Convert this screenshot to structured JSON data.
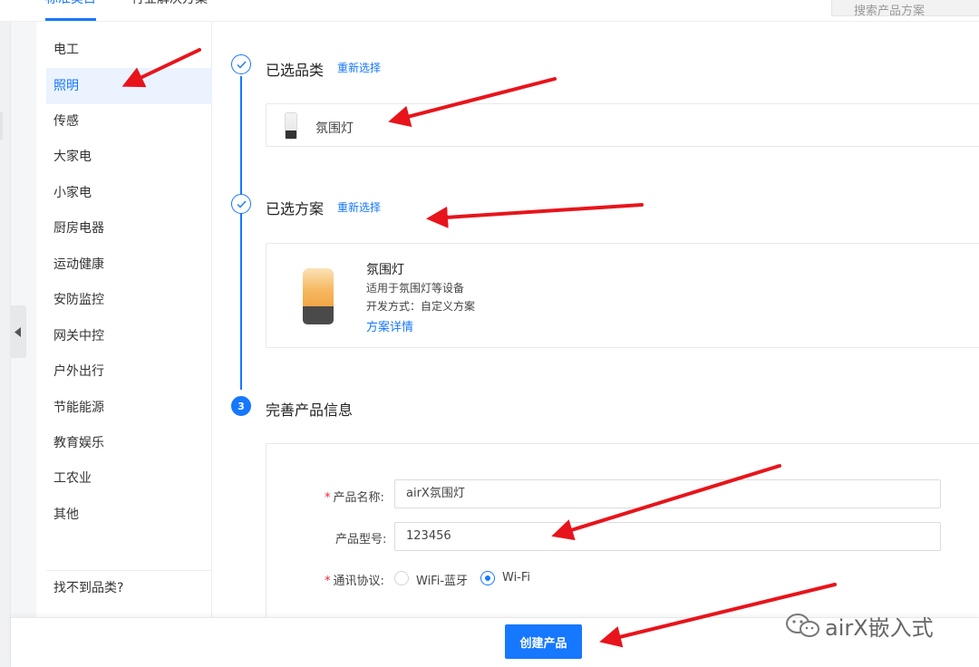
{
  "tabs": [
    {
      "label": "标准类目",
      "active": true
    },
    {
      "label": "行业解决方案",
      "active": false
    }
  ],
  "search": {
    "placeholder": "搜索产品方案"
  },
  "sidebar": {
    "categories": [
      {
        "label": "电工"
      },
      {
        "label": "照明",
        "active": true
      },
      {
        "label": "传感"
      },
      {
        "label": "大家电"
      },
      {
        "label": "小家电"
      },
      {
        "label": "厨房电器"
      },
      {
        "label": "运动健康"
      },
      {
        "label": "安防监控"
      },
      {
        "label": "网关中控"
      },
      {
        "label": "户外出行"
      },
      {
        "label": "节能能源"
      },
      {
        "label": "教育娱乐"
      },
      {
        "label": "工农业"
      },
      {
        "label": "其他"
      }
    ],
    "cant_find": "找不到品类?"
  },
  "steps": {
    "step1": {
      "title": "已选品类",
      "reselect": "重新选择",
      "selected_category": "氛围灯"
    },
    "step2": {
      "title": "已选方案",
      "reselect": "重新选择",
      "scheme_name": "氛围灯",
      "scheme_desc": "适用于氛围灯等设备",
      "scheme_mode": "开发方式：自定义方案",
      "scheme_link": "方案详情"
    },
    "step3": {
      "number": "3",
      "title": "完善产品信息"
    }
  },
  "form": {
    "product_name": {
      "label": "产品名称:",
      "value": "airX氛围灯"
    },
    "product_model": {
      "label": "产品型号:",
      "value": "123456"
    },
    "protocol": {
      "label": "通讯协议:",
      "options": [
        {
          "label": "WiFi-蓝牙",
          "checked": false
        },
        {
          "label": "Wi-Fi",
          "checked": true
        }
      ]
    }
  },
  "footer": {
    "create_label": "创建产品"
  },
  "watermark": {
    "text": "airX嵌入式"
  },
  "colors": {
    "accent": "#1677ff",
    "arrow": "#e8141b",
    "lamp_glow": "#f6b860"
  }
}
